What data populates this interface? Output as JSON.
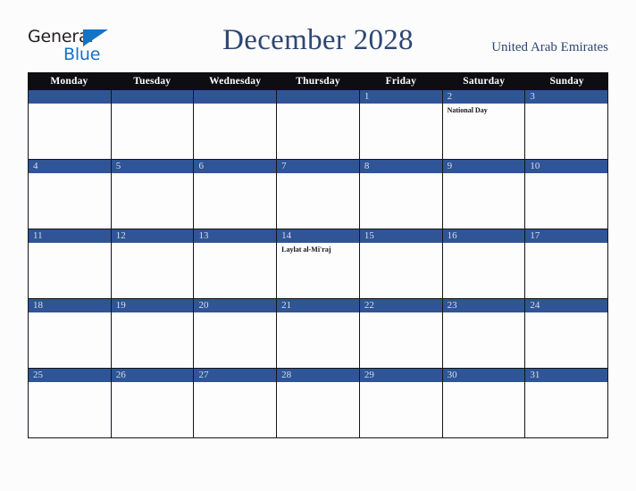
{
  "brand": {
    "word_one": "General",
    "word_two": "Blue",
    "triangle_icon": "triangle-icon",
    "color_dark": "#231f20",
    "color_blue": "#1573c6"
  },
  "header": {
    "title": "December 2028",
    "country": "United Arab Emirates",
    "title_color": "#2e4672"
  },
  "calendar": {
    "weekday_headers": [
      "Monday",
      "Tuesday",
      "Wednesday",
      "Thursday",
      "Friday",
      "Saturday",
      "Sunday"
    ],
    "header_bg": "#0d0d12",
    "date_bar_bg": "#2f5596",
    "cell_bg": "#fdfdfe",
    "weeks": [
      [
        {
          "date": "",
          "event": ""
        },
        {
          "date": "",
          "event": ""
        },
        {
          "date": "",
          "event": ""
        },
        {
          "date": "",
          "event": ""
        },
        {
          "date": "1",
          "event": ""
        },
        {
          "date": "2",
          "event": "National Day"
        },
        {
          "date": "3",
          "event": ""
        }
      ],
      [
        {
          "date": "4",
          "event": ""
        },
        {
          "date": "5",
          "event": ""
        },
        {
          "date": "6",
          "event": ""
        },
        {
          "date": "7",
          "event": ""
        },
        {
          "date": "8",
          "event": ""
        },
        {
          "date": "9",
          "event": ""
        },
        {
          "date": "10",
          "event": ""
        }
      ],
      [
        {
          "date": "11",
          "event": ""
        },
        {
          "date": "12",
          "event": ""
        },
        {
          "date": "13",
          "event": ""
        },
        {
          "date": "14",
          "event": "Laylat al-Mi'raj"
        },
        {
          "date": "15",
          "event": ""
        },
        {
          "date": "16",
          "event": ""
        },
        {
          "date": "17",
          "event": ""
        }
      ],
      [
        {
          "date": "18",
          "event": ""
        },
        {
          "date": "19",
          "event": ""
        },
        {
          "date": "20",
          "event": ""
        },
        {
          "date": "21",
          "event": ""
        },
        {
          "date": "22",
          "event": ""
        },
        {
          "date": "23",
          "event": ""
        },
        {
          "date": "24",
          "event": ""
        }
      ],
      [
        {
          "date": "25",
          "event": ""
        },
        {
          "date": "26",
          "event": ""
        },
        {
          "date": "27",
          "event": ""
        },
        {
          "date": "28",
          "event": ""
        },
        {
          "date": "29",
          "event": ""
        },
        {
          "date": "30",
          "event": ""
        },
        {
          "date": "31",
          "event": ""
        }
      ]
    ]
  }
}
